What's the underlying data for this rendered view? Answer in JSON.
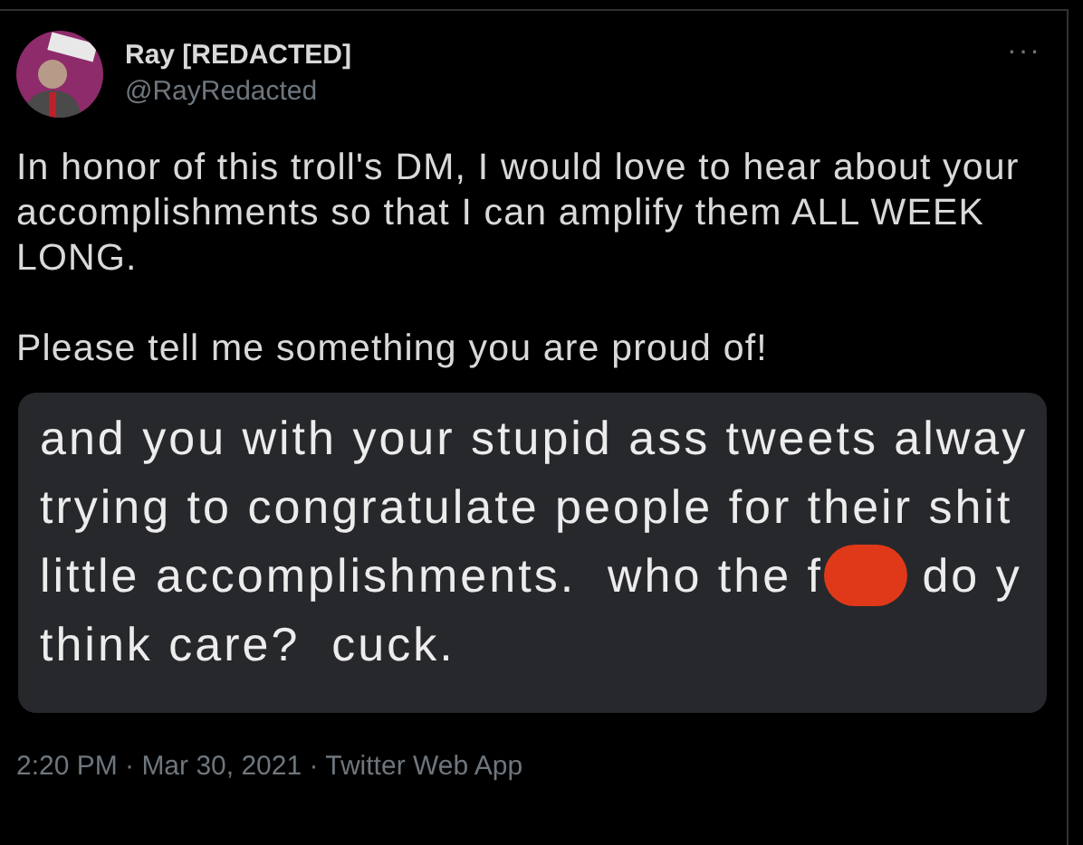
{
  "author": {
    "name": "Ray [REDACTED]",
    "handle": "@RayRedacted"
  },
  "more": "···",
  "body": [
    "In honor of this troll's DM, I would love to hear about your accomplishments so that I can amplify them ALL WEEK LONG.",
    "Please tell me something you are proud of!"
  ],
  "attachment": {
    "lines": [
      {
        "segments": [
          {
            "kind": "text",
            "text": "and you with your stupid ass tweets alway"
          }
        ]
      },
      {
        "segments": [
          {
            "kind": "text",
            "text": "trying to congratulate people for their shit"
          }
        ]
      },
      {
        "segments": [
          {
            "kind": "text",
            "text": "little accomplishments.  who the f"
          },
          {
            "kind": "redaction"
          },
          {
            "kind": "text",
            "text": " do y"
          }
        ]
      },
      {
        "segments": [
          {
            "kind": "text",
            "text": "think care?  cuck."
          }
        ]
      }
    ]
  },
  "footer": "2:20 PM · Mar 30, 2021 · Twitter Web App"
}
